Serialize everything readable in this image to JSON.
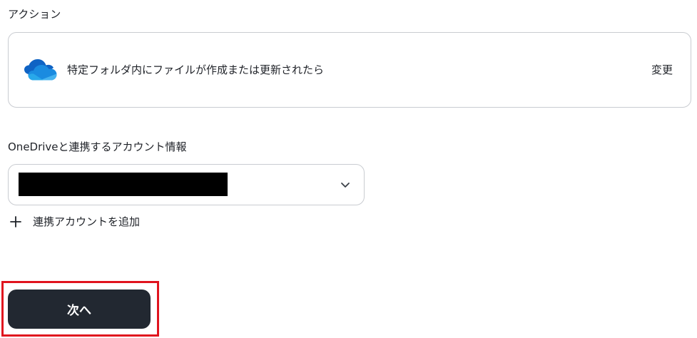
{
  "action_section": {
    "label": "アクション",
    "card": {
      "icon": "onedrive-cloud-icon",
      "text": "特定フォルダ内にファイルが作成または更新されたら",
      "change_label": "変更"
    }
  },
  "account_section": {
    "label": "OneDriveと連携するアカウント情報",
    "selected_value": "",
    "chevron_icon": "chevron-down-icon",
    "add_account_label": "連携アカウントを追加",
    "add_icon": "plus-icon"
  },
  "footer": {
    "next_label": "次へ",
    "highlight_color": "#e0141e"
  },
  "colors": {
    "button_bg": "#222831",
    "border": "#c9ccd1",
    "onedrive_blue_dark": "#0f63c4",
    "onedrive_blue_mid": "#1a8be0",
    "onedrive_blue_light": "#45b3f0"
  }
}
